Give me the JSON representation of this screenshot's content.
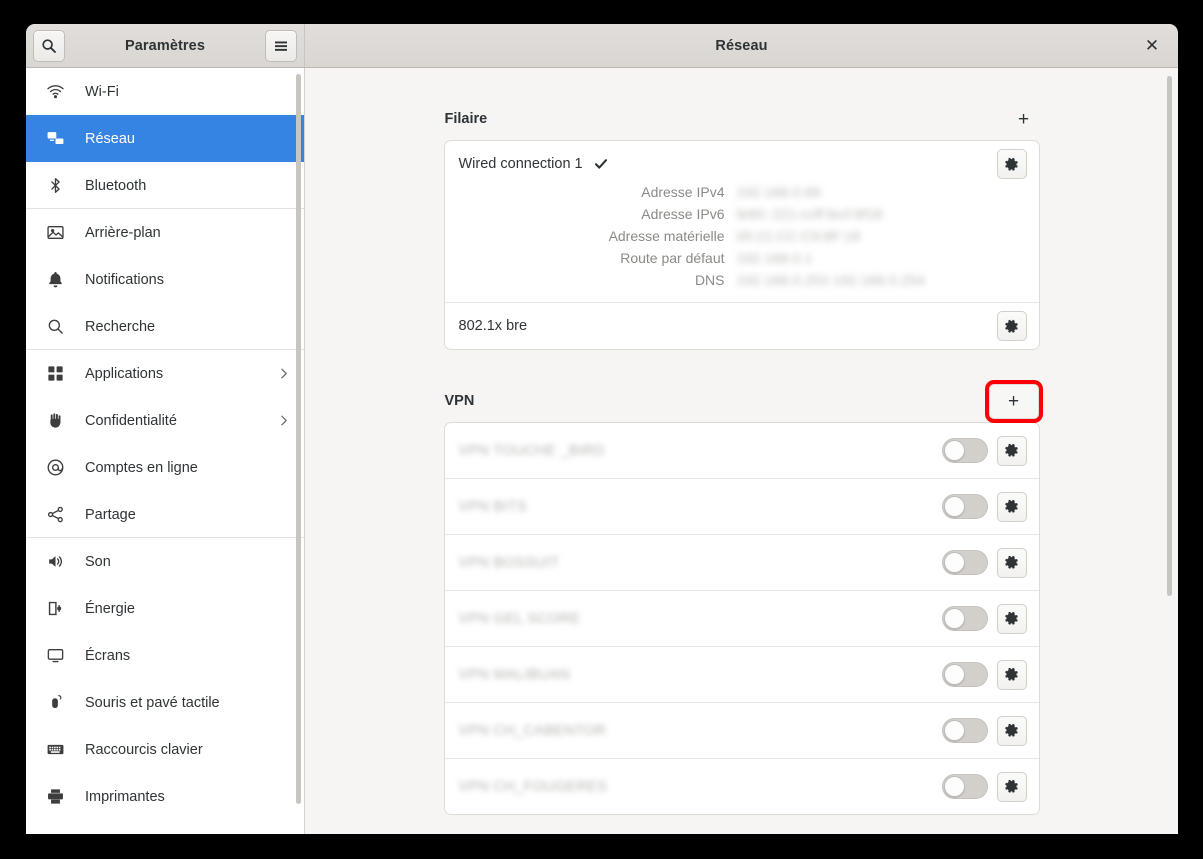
{
  "window": {
    "sidebar_title": "Paramètres",
    "main_title": "Réseau",
    "close_label": "✕",
    "search_icon": "search-icon",
    "menu_icon": "hamburger-menu-icon"
  },
  "sidebar": {
    "items": [
      {
        "label": "Wi-Fi",
        "icon": "wifi-icon",
        "selected": false,
        "chevron": false,
        "separator": false
      },
      {
        "label": "Réseau",
        "icon": "network-icon",
        "selected": true,
        "chevron": false,
        "separator": false
      },
      {
        "label": "Bluetooth",
        "icon": "bluetooth-icon",
        "selected": false,
        "chevron": false,
        "separator": true
      },
      {
        "label": "Arrière-plan",
        "icon": "wallpaper-icon",
        "selected": false,
        "chevron": false,
        "separator": false
      },
      {
        "label": "Notifications",
        "icon": "bell-icon",
        "selected": false,
        "chevron": false,
        "separator": false
      },
      {
        "label": "Recherche",
        "icon": "search-icon",
        "selected": false,
        "chevron": false,
        "separator": true
      },
      {
        "label": "Applications",
        "icon": "apps-grid-icon",
        "selected": false,
        "chevron": true,
        "separator": false
      },
      {
        "label": "Confidentialité",
        "icon": "hand-privacy-icon",
        "selected": false,
        "chevron": true,
        "separator": false
      },
      {
        "label": "Comptes en ligne",
        "icon": "at-sign-icon",
        "selected": false,
        "chevron": false,
        "separator": false
      },
      {
        "label": "Partage",
        "icon": "share-nodes-icon",
        "selected": false,
        "chevron": false,
        "separator": true
      },
      {
        "label": "Son",
        "icon": "speaker-icon",
        "selected": false,
        "chevron": false,
        "separator": false
      },
      {
        "label": "Énergie",
        "icon": "battery-power-icon",
        "selected": false,
        "chevron": false,
        "separator": false
      },
      {
        "label": "Écrans",
        "icon": "monitor-icon",
        "selected": false,
        "chevron": false,
        "separator": false
      },
      {
        "label": "Souris et pavé tactile",
        "icon": "mouse-icon",
        "selected": false,
        "chevron": false,
        "separator": false
      },
      {
        "label": "Raccourcis clavier",
        "icon": "keyboard-icon",
        "selected": false,
        "chevron": false,
        "separator": false
      },
      {
        "label": "Imprimantes",
        "icon": "printer-icon",
        "selected": false,
        "chevron": false,
        "separator": false
      }
    ]
  },
  "content": {
    "wired": {
      "title": "Filaire",
      "add_label": "+",
      "connection": {
        "name": "Wired connection 1",
        "connected_check": "✔",
        "details": [
          {
            "label": "Adresse IPv4",
            "value": "192.168.0.89",
            "redacted": true
          },
          {
            "label": "Adresse IPv6",
            "value": "fe80::221:ccff:fecf:8f18",
            "redacted": true
          },
          {
            "label": "Adresse matérielle",
            "value": "00:21:CC:C9:8F:18",
            "redacted": true
          },
          {
            "label": "Route par défaut",
            "value": "192.168.0.1",
            "redacted": true
          },
          {
            "label": "DNS",
            "value": "192.168.0.253 192.168.0.254",
            "redacted": true
          }
        ]
      },
      "secondary": {
        "name": "802.1x bre"
      }
    },
    "vpn": {
      "title": "VPN",
      "add_label": "+",
      "add_highlighted": true,
      "connections": [
        {
          "name": "VPN TOUCHE _BIRD",
          "enabled": false,
          "redacted": true
        },
        {
          "name": "VPN BITS",
          "enabled": false,
          "redacted": true
        },
        {
          "name": "VPN BOSSUIT",
          "enabled": false,
          "redacted": true
        },
        {
          "name": "VPN GEL SCORE",
          "enabled": false,
          "redacted": true
        },
        {
          "name": "VPN MALIBUAN",
          "enabled": false,
          "redacted": true
        },
        {
          "name": "VPN CH_CABENTOR",
          "enabled": false,
          "redacted": true
        },
        {
          "name": "VPN CH_FOUGERES",
          "enabled": false,
          "redacted": true
        }
      ]
    }
  },
  "highlight_color": "#fb0007",
  "accent_color": "#3584e4"
}
